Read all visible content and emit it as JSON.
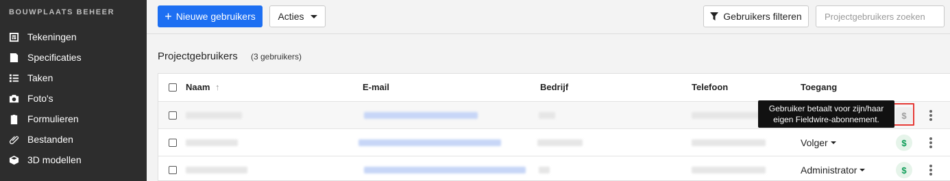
{
  "sidebar": {
    "brand": "BOUWPLAATS BEHEER",
    "items": [
      {
        "label": "Tekeningen",
        "icon": "plans-icon"
      },
      {
        "label": "Specificaties",
        "icon": "specifications-icon"
      },
      {
        "label": "Taken",
        "icon": "tasks-icon"
      },
      {
        "label": "Foto's",
        "icon": "camera-icon"
      },
      {
        "label": "Formulieren",
        "icon": "forms-icon"
      },
      {
        "label": "Bestanden",
        "icon": "paperclip-icon"
      },
      {
        "label": "3D modellen",
        "icon": "cube-icon"
      }
    ]
  },
  "toolbar": {
    "new_users_label": "Nieuwe gebruikers",
    "actions_label": "Acties",
    "filter_label": "Gebruikers filteren",
    "search_placeholder": "Projectgebruikers zoeken"
  },
  "section": {
    "title": "Projectgebruikers",
    "count": "(3 gebruikers)"
  },
  "table": {
    "columns": {
      "name": "Naam",
      "email": "E-mail",
      "company": "Bedrijf",
      "phone": "Telefoon",
      "access": "Toegang"
    },
    "rows": [
      {
        "role": "",
        "pays_own": true
      },
      {
        "role": "Volger",
        "pays_own": false
      },
      {
        "role": "Administrator",
        "pays_own": false
      }
    ]
  },
  "tooltip": {
    "line1": "Gebruiker betaalt voor zijn/haar",
    "line2": "eigen Fieldwire-abonnement."
  },
  "colors": {
    "sidebar_bg": "#2d2d2d",
    "primary": "#1d6ff2",
    "highlight": "#e53935",
    "paid_green": "#0f9d58"
  }
}
